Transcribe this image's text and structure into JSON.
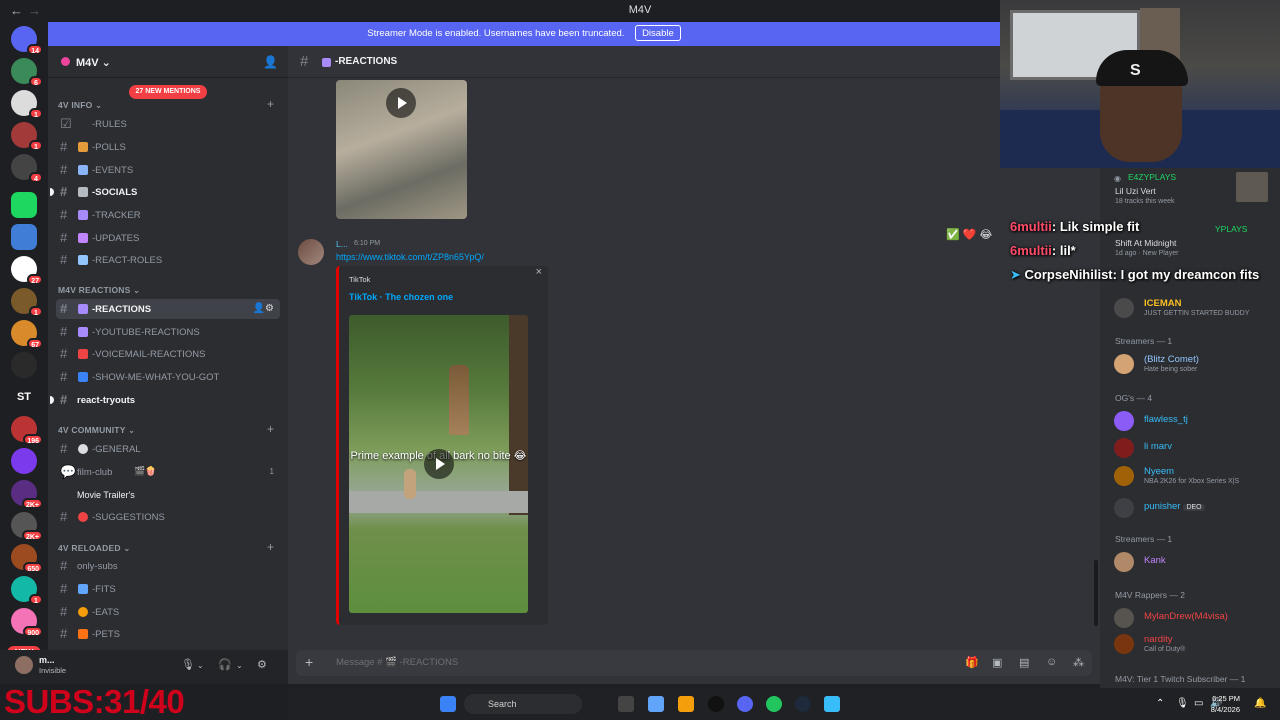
{
  "window": {
    "title": "M4V"
  },
  "banner": {
    "text": "Streamer Mode is enabled. Usernames have been truncated.",
    "button": "Disable"
  },
  "guilds": {
    "badges": [
      "14",
      "6",
      "1",
      "1",
      "4",
      "27",
      "1",
      "67",
      "2K+",
      "1",
      "196",
      "2K+",
      "2K+",
      "650",
      "1",
      "900"
    ],
    "new_label": "NEW"
  },
  "server": {
    "name": "M4V",
    "mentions": "27 NEW MENTIONS"
  },
  "categories": {
    "info": "4V INFO",
    "reactions": "M4V REACTIONS",
    "community": "4V COMMUNITY",
    "reloaded": "4V RELOADED"
  },
  "channels": {
    "rules": "-RULES",
    "polls": "-POLLS",
    "events": "-EVENTS",
    "socials": "-SOCIALS",
    "tracker": "-TRACKER",
    "updates": "-UPDATES",
    "react_roles": "-REACT-ROLES",
    "reactions": "-REACTIONS",
    "youtube_reactions": "-YOUTUBE-REACTIONS",
    "voicemail_reactions": "-VOICEMAIL-REACTIONS",
    "show_me": "-SHOW-ME-WHAT-YOU-GOT",
    "react_tryouts": "react-tryouts",
    "general": "-GENERAL",
    "film_club": "film-club",
    "film_club_count": "1",
    "movie_trailers": "Movie Trailer's",
    "suggestions": "-SUGGESTIONS",
    "only_subs": "only-subs",
    "fits": "-FITS",
    "eats": "-EATS",
    "pets": "-PETS"
  },
  "user": {
    "name": "m...",
    "status": "Invisible"
  },
  "overlay": {
    "subs": "SUBS:31/40"
  },
  "header": {
    "channel": "-REACTIONS"
  },
  "message": {
    "author": "L...",
    "time": "6:10 PM",
    "link": "https://www.tiktok.com/t/ZP8n65YpQ/",
    "reactions": "✅ ❤️ 😂"
  },
  "embed": {
    "provider": "TikTok",
    "title": "TikTok · The chozen one",
    "caption": "Prime example of all bark no bite 😂"
  },
  "composer": {
    "placeholder": "Message # 🎬 -REACTIONS"
  },
  "chat": [
    {
      "user": "6multii",
      "text": ": Lik simple fit"
    },
    {
      "user": "6multii",
      "text": ": lil*"
    },
    {
      "user": "CorpseNihilist",
      "text": ": I got my dreamcon fits"
    }
  ],
  "members": {
    "spotify1_user": "E4ZYPLAYS",
    "spotify1_track": "Lil Uzi Vert",
    "spotify1_sub": "18 tracks this week",
    "spotify2_user": "YPLAYS",
    "spotify2_track": "Shift At Midnight",
    "spotify2_sub": "1d ago · New Player",
    "iceman_name": "ICEMAN",
    "iceman_status": "JUST GETTIN STARTED BUDDY",
    "streamers1": "Streamers — 1",
    "blitz_name": "(Blitz Comet)",
    "blitz_status": "Hate being sober",
    "ogs": "OG's — 4",
    "flawless": "flawless_tj",
    "li_marv": "li marv",
    "nyeem": "Nyeem",
    "nyeem_status": "NBA 2K26 for Xbox Series X|S",
    "punisher": "punisher",
    "punisher_tag": "DEO",
    "streamers2": "Streamers — 1",
    "kank": "Kank",
    "rappers": "M4V Rappers — 2",
    "mylandrew": "MylanDrew(M4visa)",
    "nardity": "nardity",
    "nardity_status": "Call of Duty®",
    "tier1": "M4V: Tier 1 Twitch Subscriber — 1"
  },
  "taskbar": {
    "search": "Search",
    "time": "6:25 PM",
    "date": "8/4/2026"
  },
  "colors": {
    "blurple": "#5865f2",
    "danger": "#f23f43",
    "link": "#00a8fc"
  }
}
